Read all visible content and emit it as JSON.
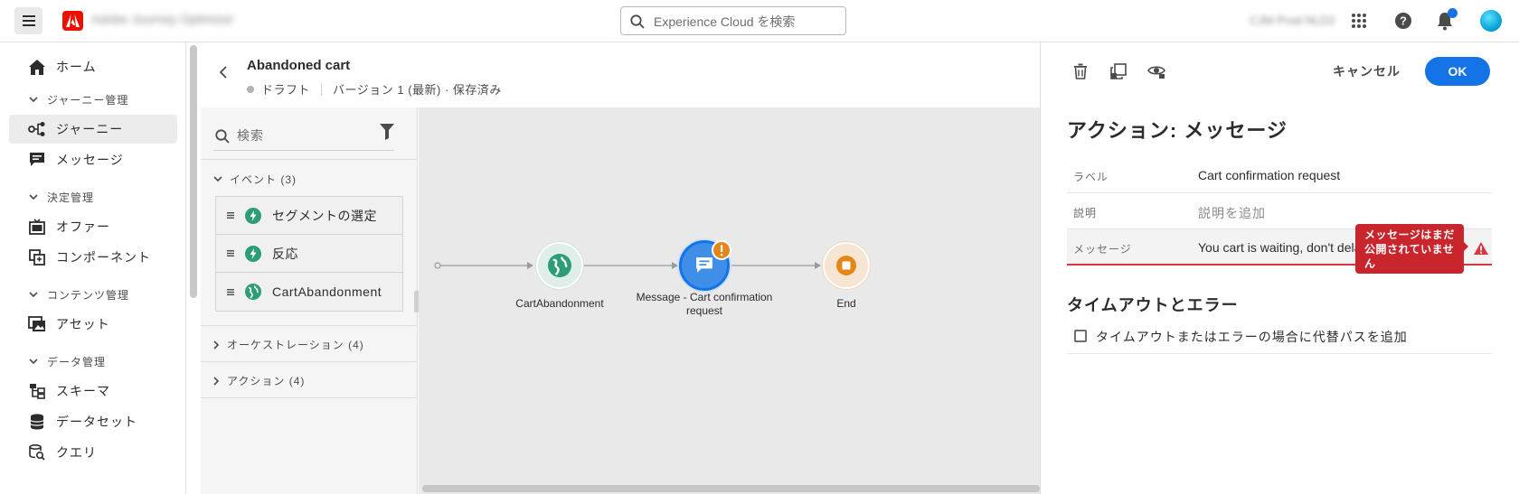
{
  "topbar": {
    "app_name": "Adobe Journey Optimizer",
    "search_placeholder": "Experience Cloud を検索",
    "org_name": "CJM Prod NLD2"
  },
  "leftnav": {
    "items": [
      {
        "type": "item",
        "label": "ホーム",
        "icon": "home-icon"
      },
      {
        "type": "group",
        "label": "ジャーニー管理"
      },
      {
        "type": "item",
        "label": "ジャーニー",
        "icon": "journey-icon",
        "active": true
      },
      {
        "type": "item",
        "label": "メッセージ",
        "icon": "message-icon"
      },
      {
        "type": "group",
        "label": "決定管理"
      },
      {
        "type": "item",
        "label": "オファー",
        "icon": "offer-icon"
      },
      {
        "type": "item",
        "label": "コンポーネント",
        "icon": "components-icon"
      },
      {
        "type": "group",
        "label": "コンテンツ管理"
      },
      {
        "type": "item",
        "label": "アセット",
        "icon": "assets-icon"
      },
      {
        "type": "group",
        "label": "データ管理"
      },
      {
        "type": "item",
        "label": "スキーマ",
        "icon": "schema-icon"
      },
      {
        "type": "item",
        "label": "データセット",
        "icon": "dataset-icon"
      },
      {
        "type": "item",
        "label": "クエリ",
        "icon": "query-icon"
      }
    ]
  },
  "journey": {
    "title": "Abandoned cart",
    "status": "ドラフト",
    "version": "バージョン 1 (最新) · 保存済み"
  },
  "palette": {
    "search_placeholder": "検索",
    "events_header": "イベント (3)",
    "events": [
      "セグメントの選定",
      "反応",
      "CartAbandonment"
    ],
    "orchestration_header": "オーケストレーション (4)",
    "actions_header": "アクション (4)"
  },
  "canvas": {
    "nodes": [
      {
        "label": "CartAbandonment",
        "kind": "event"
      },
      {
        "label": "Message - Cart confirmation request",
        "kind": "message",
        "warning": true
      },
      {
        "label": "End",
        "kind": "end"
      }
    ]
  },
  "panel": {
    "cancel_label": "キャンセル",
    "ok_label": "OK",
    "title": "アクション: メッセージ",
    "fields": {
      "label_label": "ラベル",
      "label_value": "Cart confirmation request",
      "description_label": "説明",
      "description_placeholder": "説明を追加",
      "message_label": "メッセージ",
      "message_value": "You cart is waiting, don't delay"
    },
    "error_tooltip": "メッセージはまだ公開されていません",
    "timeout_section_title": "タイムアウトとエラー",
    "timeout_checkbox_label": "タイムアウトまたはエラーの場合に代替パスを追加"
  },
  "colors": {
    "accent": "#1473e6",
    "error": "#d7373f",
    "event_node": "#2d9d78",
    "end_node": "#e68619",
    "warning": "#e68619"
  }
}
